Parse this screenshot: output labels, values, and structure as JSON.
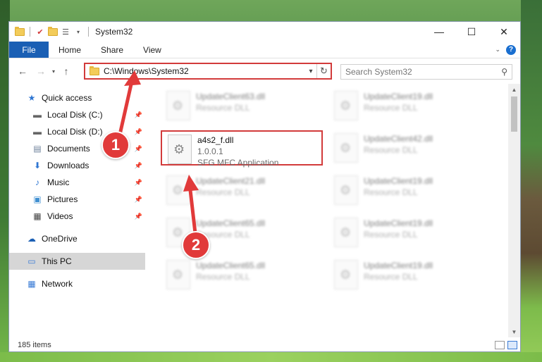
{
  "window": {
    "title": "System32",
    "controls": {
      "minimize": "—",
      "maximize": "☐",
      "close": "✕"
    }
  },
  "ribbon": {
    "tabs": [
      "File",
      "Home",
      "Share",
      "View"
    ]
  },
  "address": {
    "path": "C:\\Windows\\System32",
    "search_placeholder": "Search System32"
  },
  "nav": {
    "quick_access": "Quick access",
    "items": [
      {
        "label": "Local Disk (C:)",
        "icon": "drive-icon"
      },
      {
        "label": "Local Disk (D:)",
        "icon": "drive-icon"
      },
      {
        "label": "Documents",
        "icon": "documents-icon"
      },
      {
        "label": "Downloads",
        "icon": "downloads-icon"
      },
      {
        "label": "Music",
        "icon": "music-icon"
      },
      {
        "label": "Pictures",
        "icon": "pictures-icon"
      },
      {
        "label": "Videos",
        "icon": "videos-icon"
      }
    ],
    "onedrive": "OneDrive",
    "this_pc": "This PC",
    "network": "Network"
  },
  "files": {
    "highlighted": {
      "name": "a4s2_f.dll",
      "version": "1.0.0.1",
      "description": "SFG MFC Application"
    },
    "left": [
      {
        "name": "UpdateClient63.dll",
        "sub": "Resource DLL"
      },
      {
        "name": "UpdateClient21.dll",
        "sub": "Resource DLL"
      },
      {
        "name": "UpdateClient65.dll",
        "sub": "Resource DLL"
      },
      {
        "name": "UpdateClient65.dll",
        "sub": "Resource DLL"
      }
    ],
    "right": [
      {
        "name": "UpdateClient19.dll",
        "sub": "Resource DLL"
      },
      {
        "name": "UpdateClient42.dll",
        "sub": "Resource DLL"
      },
      {
        "name": "UpdateClient19.dll",
        "sub": "Resource DLL"
      },
      {
        "name": "UpdateClient19.dll",
        "sub": "Resource DLL"
      },
      {
        "name": "UpdateClient19.dll",
        "sub": "Resource DLL"
      }
    ]
  },
  "status": {
    "item_count": "185 items"
  },
  "annotations": {
    "step1": "1",
    "step2": "2",
    "color": "#e13a3a"
  }
}
